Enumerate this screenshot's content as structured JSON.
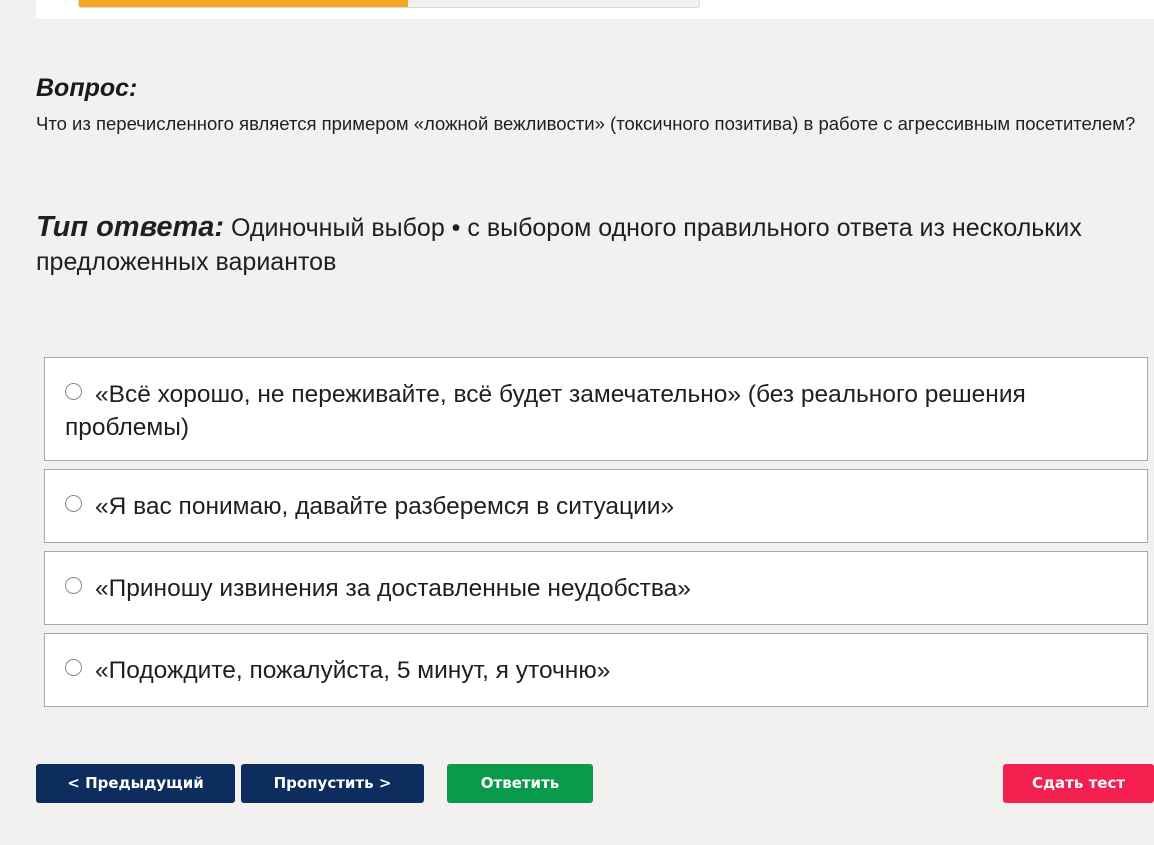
{
  "progress": {
    "fraction": 0.53
  },
  "question": {
    "label": "Вопрос:",
    "text": "Что из перечисленного является примером «ложной вежливости» (токсичного позитива) в работе с агрессивным посетителем?"
  },
  "answer_type": {
    "label": "Тип ответа:",
    "value": " Одиночный выбор • с выбором одного правильного ответа из нескольких предложенных вариантов"
  },
  "options": [
    {
      "text": "«Всё хорошо, не переживайте, всё будет замечательно» (без реального решения проблемы)"
    },
    {
      "text": "«Я вас понимаю, давайте разберемся в ситуации»"
    },
    {
      "text": "«Приношу извинения за доставленные неудобства»"
    },
    {
      "text": "«Подождите, пожалуйста, 5 минут, я уточню»"
    }
  ],
  "buttons": {
    "previous": "< Предыдущий",
    "skip": "Пропустить >",
    "answer": "Ответить",
    "submit": "Сдать тест"
  },
  "colors": {
    "progress_fill": "#f5a623",
    "nav_button": "#0d2d5e",
    "answer_button": "#0a9b4a",
    "submit_button": "#f3204f",
    "background": "#f2f1ef"
  }
}
